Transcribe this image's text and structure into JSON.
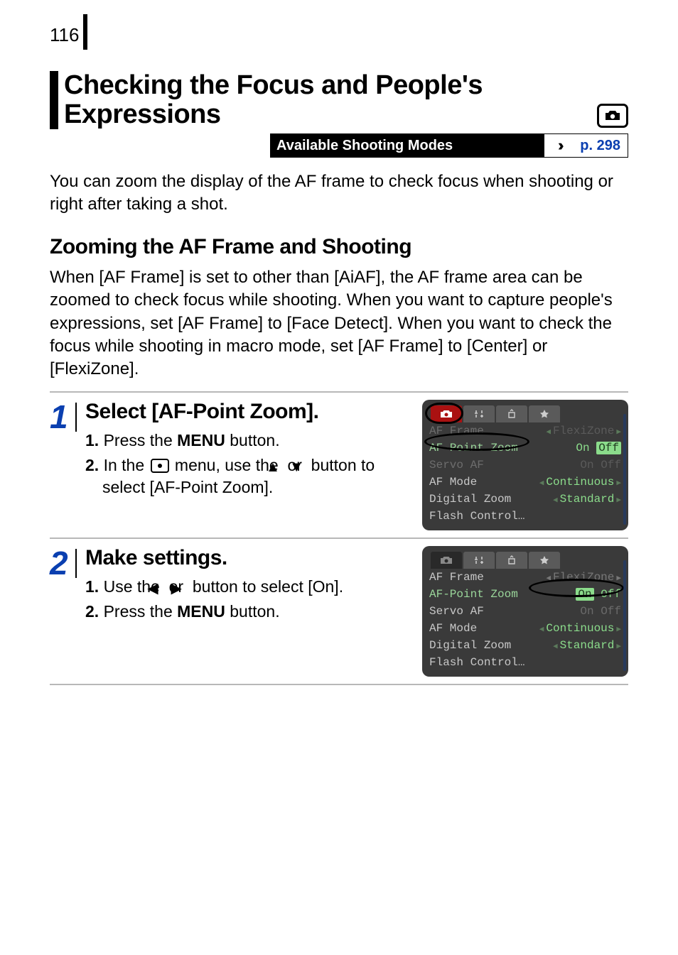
{
  "page_number": "116",
  "heading": "Checking the Focus and People's Expressions",
  "modes_label": "Available Shooting Modes",
  "modes_link": "p. 298",
  "intro_text": "You can zoom the display of the AF frame to check focus when shooting or right after taking a shot.",
  "sub_heading": "Zooming the AF Frame and Shooting",
  "sub_text": "When [AF Frame] is set to other than [AiAF], the AF frame area can be zoomed to check focus while shooting. When you want to capture people's expressions, set [AF Frame] to [Face Detect]. When you want to check the focus while shooting in macro mode, set [AF Frame] to [Center] or [FlexiZone].",
  "steps": [
    {
      "num": "1",
      "title": "Select [AF-Point Zoom].",
      "items": {
        "a_prefix": "1.",
        "a_text1": " Press the ",
        "a_bold": "MENU",
        "a_text2": " button.",
        "b_prefix": "2.",
        "b_text1": " In the ",
        "b_text2": " menu, use the ",
        "b_text3": " or ",
        "b_text4": " button to select [AF-Point Zoom]."
      },
      "menu": {
        "r1": {
          "label": "AF Frame",
          "value": "FlexiZone"
        },
        "r2": {
          "label": "AF-Point Zoom",
          "on": "On",
          "off": "Off"
        },
        "r3": {
          "label": "Servo AF",
          "on": "On",
          "off": "Off"
        },
        "r4": {
          "label": "AF Mode",
          "value": "Continuous"
        },
        "r5": {
          "label": "Digital Zoom",
          "value": "Standard"
        },
        "r6": {
          "label": "Flash Control…"
        }
      }
    },
    {
      "num": "2",
      "title": "Make settings.",
      "items": {
        "a_prefix": "1.",
        "a_text1": " Use the ",
        "a_text2": " or ",
        "a_text3": " button to select [On].",
        "b_prefix": "2.",
        "b_text1": " Press the ",
        "b_bold": "MENU",
        "b_text2": " button."
      },
      "menu": {
        "r1": {
          "label": "AF Frame",
          "value": "FlexiZone"
        },
        "r2": {
          "label": "AF-Point Zoom",
          "on": "On",
          "off": "Off"
        },
        "r3": {
          "label": "Servo AF",
          "on": "On",
          "off": "Off"
        },
        "r4": {
          "label": "AF Mode",
          "value": "Continuous"
        },
        "r5": {
          "label": "Digital Zoom",
          "value": "Standard"
        },
        "r6": {
          "label": "Flash Control…"
        }
      }
    }
  ]
}
